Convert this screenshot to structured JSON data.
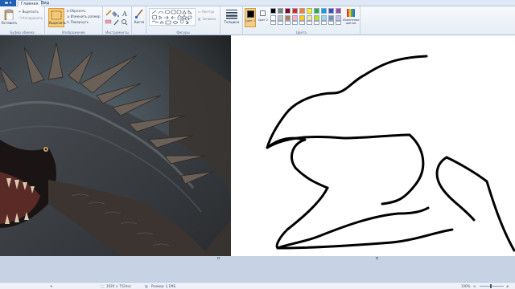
{
  "tabs": {
    "file": "▬ ▾",
    "home": "Главная",
    "view": "Вид"
  },
  "clipboard": {
    "paste": "Вставить",
    "cut": "Вырезать",
    "copy": "Копировать",
    "label": "Буфер обмена"
  },
  "image": {
    "select": "Выделить",
    "crop": "Обрезать",
    "resize": "Изменить размер",
    "rotate": "Повернуть",
    "label": "Изображение"
  },
  "tools": {
    "label": "Инструменты"
  },
  "brushes": {
    "label": "Кисти"
  },
  "shapes": {
    "outline": "Контур",
    "fill": "Заливка",
    "label": "Фигуры"
  },
  "size": {
    "label": "Толщина"
  },
  "colors": {
    "color1": "Цвет 1",
    "color2": "Цвет 2",
    "edit": "Изменение цветов",
    "label": "Цвета",
    "primary": "#000000",
    "secondary": "#ffffff",
    "palette_row1": [
      "#000000",
      "#7f7f7f",
      "#880015",
      "#ed1c24",
      "#ff7f27",
      "#fff200",
      "#22b14c",
      "#00a2e8",
      "#3f48cc",
      "#a349a4"
    ],
    "palette_row2": [
      "#ffffff",
      "#c3c3c3",
      "#b97a57",
      "#ffaec9",
      "#ffc90e",
      "#efe4b0",
      "#b5e61d",
      "#99d9ea",
      "#7092be",
      "#c8bfe7"
    ]
  },
  "status": {
    "dimensions": "1920 × 752пкс",
    "filesize": "Размер: 1,1МБ",
    "zoom": "100%"
  }
}
